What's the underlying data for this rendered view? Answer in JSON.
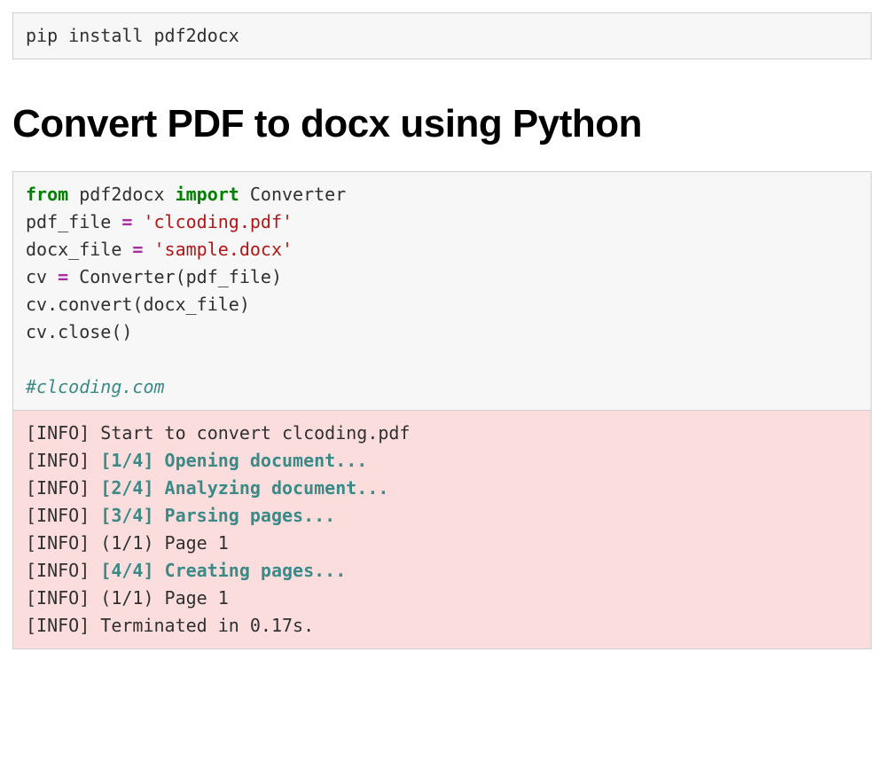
{
  "cell1": {
    "line1": "pip install pdf2docx"
  },
  "heading": "Convert PDF to docx using Python",
  "cell2": {
    "kw_from": "from",
    "mod": " pdf2docx ",
    "kw_import": "import",
    "cls": " Converter",
    "l2_a": "pdf_file ",
    "l2_op": "=",
    "l2_b": " ",
    "l2_str": "'clcoding.pdf'",
    "l3_a": "docx_file ",
    "l3_op": "=",
    "l3_b": " ",
    "l3_str": "'sample.docx'",
    "l4_a": "cv ",
    "l4_op": "=",
    "l4_b": " Converter(pdf_file)",
    "l5": "cv.convert(docx_file)",
    "l6": "cv.close()",
    "blank": "",
    "comment": "#clcoding.com"
  },
  "output": {
    "l1": "[INFO] Start to convert clcoding.pdf",
    "l2_a": "[INFO] ",
    "l2_b": "[1/4] Opening document...",
    "l3_a": "[INFO] ",
    "l3_b": "[2/4] Analyzing document...",
    "l4_a": "[INFO] ",
    "l4_b": "[3/4] Parsing pages...",
    "l5": "[INFO] (1/1) Page 1",
    "l6_a": "[INFO] ",
    "l6_b": "[4/4] Creating pages...",
    "l7": "[INFO] (1/1) Page 1",
    "l8": "[INFO] Terminated in 0.17s."
  }
}
